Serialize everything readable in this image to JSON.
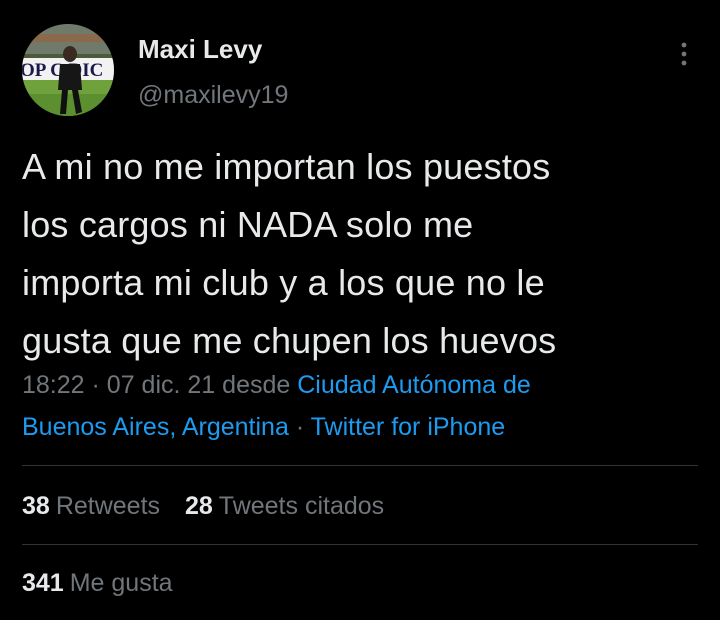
{
  "author": {
    "name": "Maxi Levy",
    "handle": "@maxilevy19",
    "avatar_banner_text": "OP C  DIC"
  },
  "tweet": {
    "text_lines": [
      "A mi no me importan los puestos",
      "los cargos ni NADA solo me",
      "importa mi club y a los que no le",
      "gusta que me chupen los huevos"
    ]
  },
  "meta": {
    "time": "18:22",
    "separator": "·",
    "date": "07 dic. 21",
    "from_label": "desde",
    "location_line1": "Ciudad Autónoma de",
    "location_line2": "Buenos Aires, Argentina",
    "source": "Twitter for iPhone"
  },
  "stats": {
    "retweets": {
      "count": "38",
      "label": "Retweets"
    },
    "quotes": {
      "count": "28",
      "label": "Tweets citados"
    },
    "likes": {
      "count": "341",
      "label": "Me gusta"
    }
  },
  "icons": {
    "more": "more-vertical-icon"
  },
  "colors": {
    "background": "#000000",
    "text_primary": "#e7e9ea",
    "text_secondary": "#71767b",
    "link": "#1d9bf0",
    "divider": "#2f3336"
  }
}
